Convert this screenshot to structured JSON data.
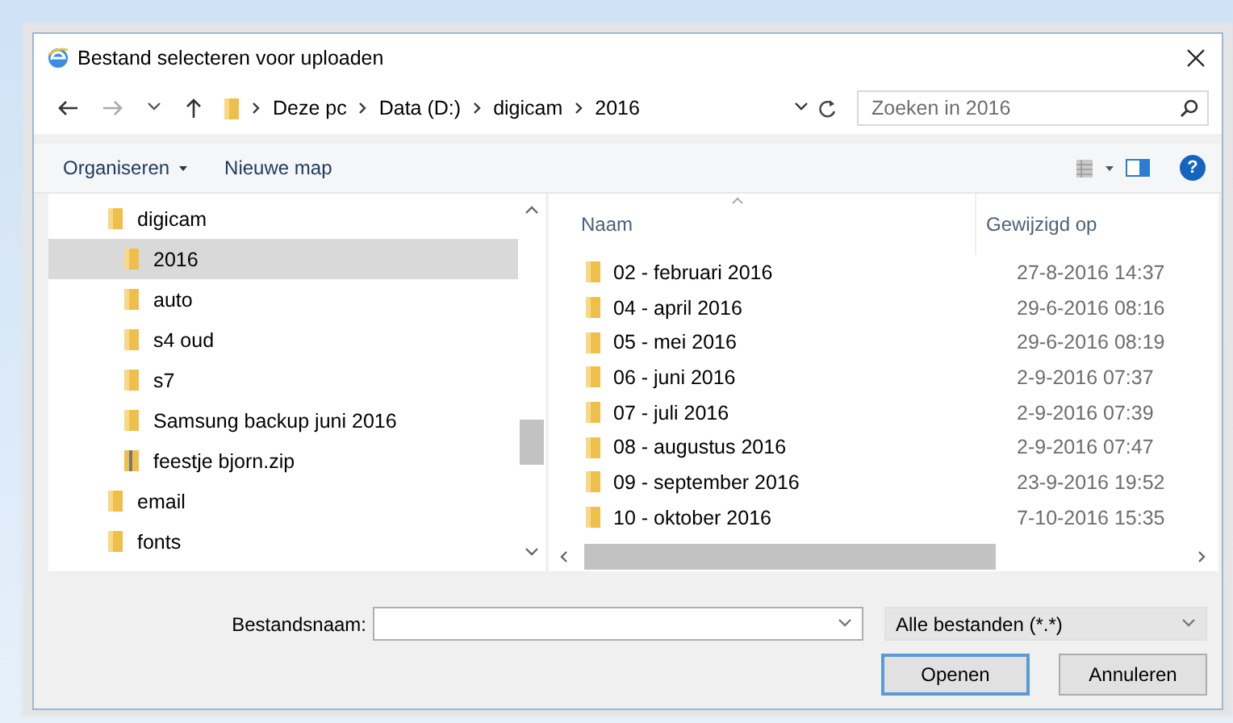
{
  "window": {
    "title": "Bestand selecteren voor uploaden"
  },
  "address": {
    "path": [
      "Deze pc",
      "Data (D:)",
      "digicam",
      "2016"
    ]
  },
  "search": {
    "placeholder": "Zoeken in 2016"
  },
  "toolbar": {
    "buttons": [
      "Organiseren",
      "Nieuwe map"
    ],
    "help": "?"
  },
  "tree": [
    {
      "label": "digicam",
      "kind": "folder",
      "selected": false,
      "children": [
        {
          "label": "2016",
          "kind": "folder",
          "selected": true
        },
        {
          "label": "auto",
          "kind": "folder",
          "selected": false
        },
        {
          "label": "s4 oud",
          "kind": "folder",
          "selected": false
        },
        {
          "label": "s7",
          "kind": "folder",
          "selected": false
        },
        {
          "label": "Samsung backup juni 2016",
          "kind": "folder",
          "selected": false
        },
        {
          "label": "feestje bjorn.zip",
          "kind": "zip",
          "selected": false
        }
      ]
    },
    {
      "label": "email",
      "kind": "folder",
      "selected": false
    },
    {
      "label": "fonts",
      "kind": "folder",
      "selected": false
    }
  ],
  "columns": [
    "Naam",
    "Gewijzigd op"
  ],
  "files": [
    {
      "name": "02 - februari 2016",
      "modified": "27-8-2016 14:37"
    },
    {
      "name": "04 - april 2016",
      "modified": "29-6-2016 08:16"
    },
    {
      "name": "05 - mei 2016",
      "modified": "29-6-2016 08:19"
    },
    {
      "name": "06 - juni 2016",
      "modified": "2-9-2016 07:37"
    },
    {
      "name": "07 - juli 2016",
      "modified": "2-9-2016 07:39"
    },
    {
      "name": "08 - augustus 2016",
      "modified": "2-9-2016 07:47"
    },
    {
      "name": "09 - september 2016",
      "modified": "23-9-2016 19:52"
    },
    {
      "name": "10 - oktober 2016",
      "modified": "7-10-2016 15:35"
    }
  ],
  "filename": {
    "label": "Bestandsnaam:"
  },
  "filetype": {
    "value": "Alle bestanden (*.*)"
  },
  "buttons": [
    {
      "label": "Openen",
      "default": true
    },
    {
      "label": "Annuleren",
      "default": false
    }
  ]
}
